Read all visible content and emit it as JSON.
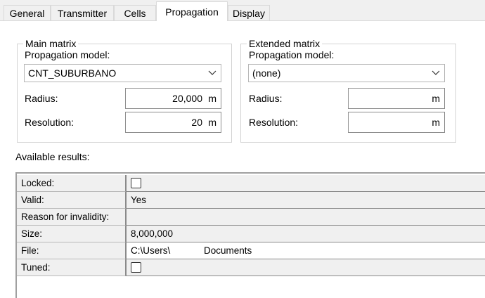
{
  "tabs": [
    "General",
    "Transmitter",
    "Cells",
    "Propagation",
    "Display"
  ],
  "active_tab": "Propagation",
  "main_matrix": {
    "title": "Main matrix",
    "model_label": "Propagation model:",
    "model_value": "CNT_SUBURBANO",
    "radius_label": "Radius:",
    "radius_value": "20,000",
    "radius_unit": "m",
    "resolution_label": "Resolution:",
    "resolution_value": "20",
    "resolution_unit": "m"
  },
  "extended_matrix": {
    "title": "Extended matrix",
    "model_label": "Propagation model:",
    "model_value": "(none)",
    "radius_label": "Radius:",
    "radius_value": "",
    "radius_unit": "m",
    "resolution_label": "Resolution:",
    "resolution_value": "",
    "resolution_unit": "m"
  },
  "results": {
    "label": "Available results:",
    "rows": [
      {
        "name": "Locked:",
        "value": "",
        "checked": false
      },
      {
        "name": "Valid:",
        "value": "Yes"
      },
      {
        "name": "Reason for invalidity:",
        "value": ""
      },
      {
        "name": "Size:",
        "value": "8,000,000"
      },
      {
        "name": "File:",
        "value_part1": "C:\\Users\\",
        "value_part2": "Documents"
      },
      {
        "name": "Tuned:",
        "value": "",
        "checked": false
      }
    ]
  }
}
